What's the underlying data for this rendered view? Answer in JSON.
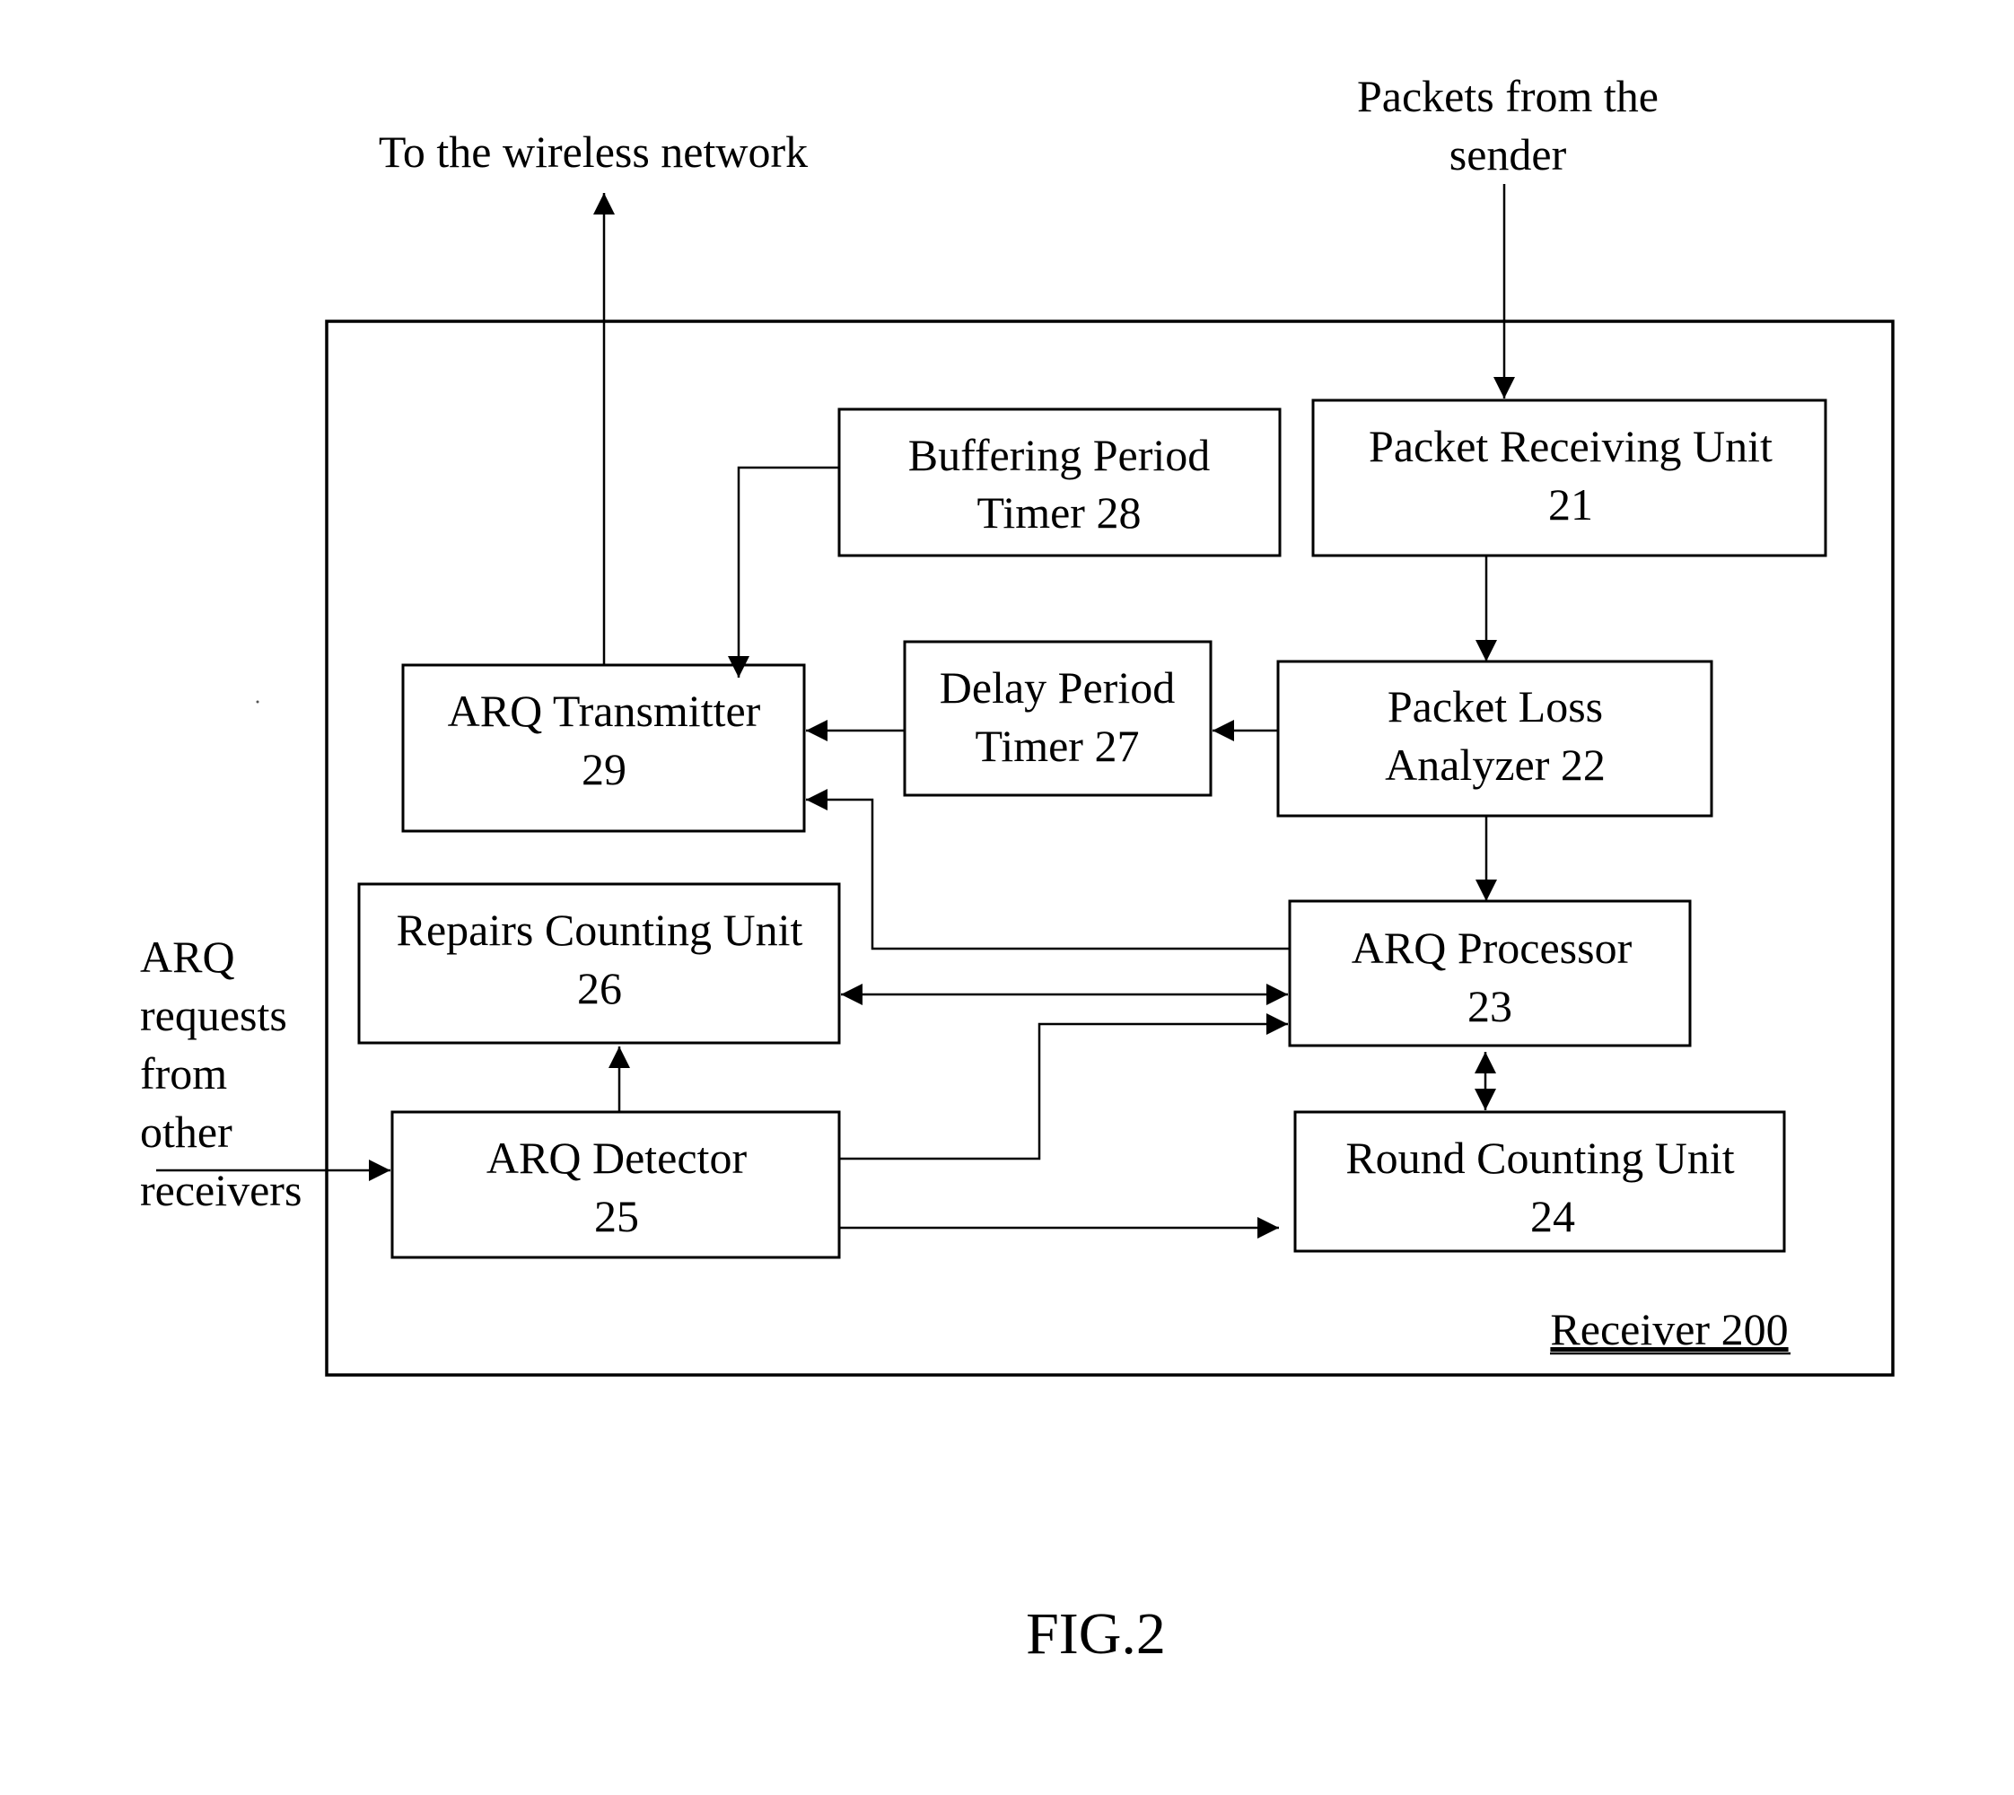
{
  "figure": {
    "caption": "FIG.2",
    "container_label": "Receiver 200",
    "external_labels": {
      "output": "To the wireless network",
      "input_lines": [
        "Packets from the",
        "sender"
      ],
      "arq_requests_lines": [
        "ARQ",
        "requests",
        "from",
        "other",
        "receivers"
      ]
    },
    "blocks": {
      "packet_receiving_unit": [
        "Packet Receiving Unit",
        "21"
      ],
      "packet_loss_analyzer": [
        "Packet Loss",
        "Analyzer 22"
      ],
      "arq_processor": [
        "ARQ Processor",
        "23"
      ],
      "round_counting_unit": [
        "Round Counting Unit",
        "24"
      ],
      "arq_detector": [
        "ARQ Detector",
        "25"
      ],
      "repairs_counting_unit": [
        "Repairs Counting Unit",
        "26"
      ],
      "delay_period_timer": [
        "Delay Period",
        "Timer 27"
      ],
      "buffering_period_timer": [
        "Buffering Period",
        "Timer 28"
      ],
      "arq_transmitter": [
        "ARQ Transmitter",
        "29"
      ]
    },
    "connections": [
      {
        "from": "Packets from the sender",
        "to": "Packet Receiving Unit 21"
      },
      {
        "from": "Packet Receiving Unit 21",
        "to": "Packet Loss Analyzer 22"
      },
      {
        "from": "Packet Loss Analyzer 22",
        "to": "Delay Period Timer 27"
      },
      {
        "from": "Packet Loss Analyzer 22",
        "to": "ARQ Processor 23"
      },
      {
        "from": "Delay Period Timer 27",
        "to": "ARQ Transmitter 29"
      },
      {
        "from": "Buffering Period Timer 28",
        "to": "ARQ Transmitter 29"
      },
      {
        "from": "ARQ Processor 23",
        "to": "ARQ Transmitter 29"
      },
      {
        "from": "ARQ Processor 23",
        "to": "Repairs Counting Unit 26",
        "bidirectional": true
      },
      {
        "from": "ARQ Processor 23",
        "to": "Round Counting Unit 24",
        "bidirectional": true
      },
      {
        "from": "ARQ Detector 25",
        "to": "ARQ Processor 23"
      },
      {
        "from": "ARQ Detector 25",
        "to": "Round Counting Unit 24"
      },
      {
        "from": "ARQ Detector 25",
        "to": "Repairs Counting Unit 26"
      },
      {
        "from": "ARQ requests from other receivers",
        "to": "ARQ Detector 25"
      },
      {
        "from": "ARQ Transmitter 29",
        "to": "To the wireless network"
      }
    ]
  }
}
